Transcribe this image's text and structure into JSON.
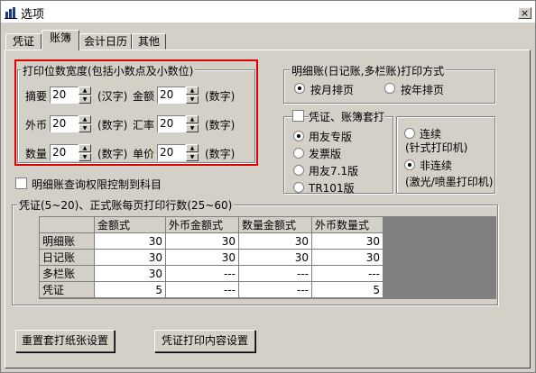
{
  "window": {
    "title": "选项",
    "close": "×"
  },
  "tabs": [
    "凭证",
    "账簿",
    "会计日历",
    "其他"
  ],
  "print_width": {
    "legend": "打印位数宽度(包括小数点及小数位)",
    "rows": [
      {
        "l1": "摘要",
        "v1": "20",
        "u1": "(汉字)",
        "l2": "金额",
        "v2": "20",
        "u2": "(数字)"
      },
      {
        "l1": "外币",
        "v1": "20",
        "u1": "(数字)",
        "l2": "汇率",
        "v2": "20",
        "u2": "(数字)"
      },
      {
        "l1": "数量",
        "v1": "20",
        "u1": "(数字)",
        "l2": "单价",
        "v2": "20",
        "u2": "(数字)"
      }
    ]
  },
  "detail_print": {
    "legend": "明细账(日记账,多栏账)打印方式",
    "by_month": "按月排页",
    "by_year": "按年排页"
  },
  "voucher_print": {
    "legend": "凭证、账簿套打",
    "options": [
      "用友专版",
      "发票版",
      "用友7.1版",
      "TR101版"
    ],
    "continuous": "连续",
    "continuous_sub": "(针式打印机)",
    "noncontinuous": "非连续",
    "noncontinuous_sub": "(激光/喷墨打印机)"
  },
  "query_check": "明细账查询权限控制到科目",
  "lines_group": {
    "legend": "凭证(5~20)、正式账每页打印行数(25~60)",
    "headers": [
      "",
      "金额式",
      "外币金额式",
      "数量金额式",
      "外币数量式"
    ],
    "rows": [
      {
        "name": "明细账",
        "cells": [
          "30",
          "30",
          "30",
          "30"
        ]
      },
      {
        "name": "日记账",
        "cells": [
          "30",
          "30",
          "30",
          "30"
        ]
      },
      {
        "name": "多栏账",
        "cells": [
          "30",
          "---",
          "---",
          "---"
        ]
      },
      {
        "name": "凭证",
        "cells": [
          "5",
          "---",
          "---",
          "5"
        ]
      }
    ]
  },
  "buttons": {
    "reset": "重置套打纸张设置",
    "voucher_content": "凭证打印内容设置"
  }
}
